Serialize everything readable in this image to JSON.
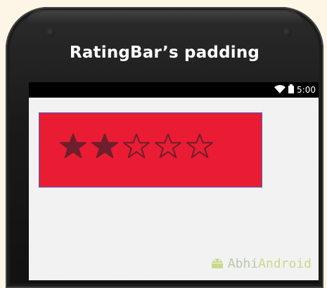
{
  "app": {
    "title": "RatingBar’s padding"
  },
  "status_bar": {
    "time": "5:00",
    "icons": [
      "wifi-icon",
      "battery-icon"
    ]
  },
  "rating_bar": {
    "rating": 2,
    "max": 5,
    "background_color": "#e91c34",
    "filled_star_color": "#6e1f2d",
    "empty_star_color": "#6e1f2d",
    "border_color": "#4a63c8"
  },
  "watermark": {
    "part1": "Abhi",
    "part2": "Android"
  }
}
